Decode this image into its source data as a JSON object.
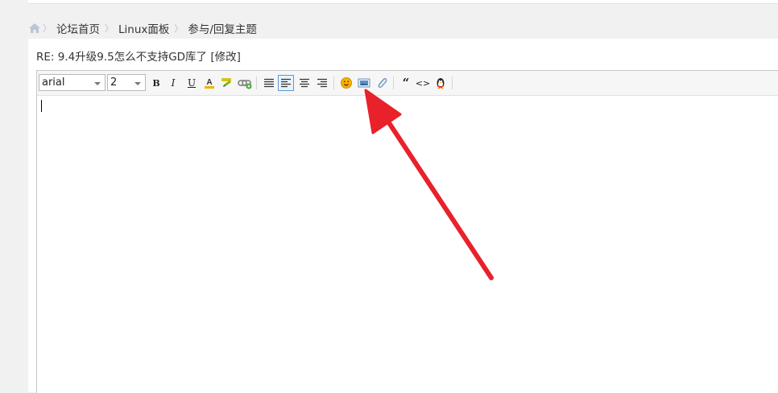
{
  "breadcrumb": {
    "items": [
      "论坛首页",
      "Linux面板",
      "参与/回复主题"
    ]
  },
  "post": {
    "title": "RE: 9.4升级9.5怎么不支持GD库了 [修改]"
  },
  "toolbar": {
    "font_family": "arial",
    "font_size": "2",
    "bold": "B",
    "italic": "I",
    "underline": "U",
    "font_color": "A",
    "quote": "“",
    "code": "<>"
  },
  "colors": {
    "accent": "#5b9bd5",
    "arrow": "#e8212b"
  }
}
